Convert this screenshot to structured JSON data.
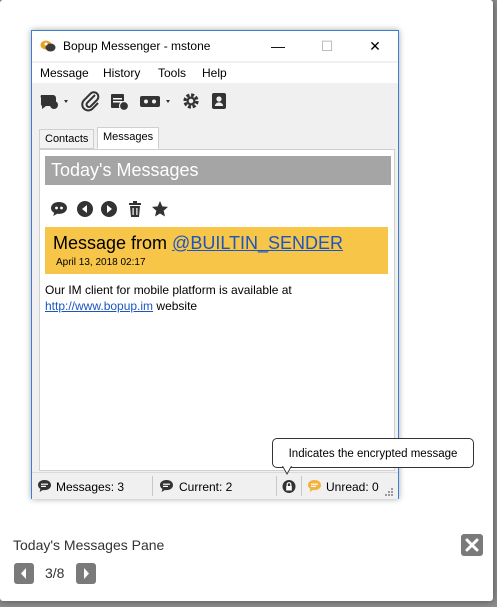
{
  "window": {
    "title": "Bopup Messenger - mstone",
    "minimize_label": "—",
    "maximize_label": "☐",
    "close_label": "✕"
  },
  "menu": [
    "Message",
    "History",
    "Tools",
    "Help"
  ],
  "tabs": [
    {
      "label": "Contacts",
      "active": false
    },
    {
      "label": "Messages",
      "active": true
    }
  ],
  "pane": {
    "header": "Today's Messages",
    "message": {
      "from_prefix": "Message from ",
      "sender": "@BUILTIN_SENDER",
      "date": "April 13, 2018 02:17",
      "body_line1": "Our IM client for mobile platform is available at",
      "link": "http://www.bopup.im",
      "body_suffix": " website"
    }
  },
  "status": {
    "messages": "Messages: 3",
    "current": "Current: 2",
    "unread": "Unread: 0"
  },
  "tooltip": "Indicates the encrypted message",
  "lightbox": {
    "caption": "Today's Messages Pane",
    "counter": "3/8"
  },
  "colors": {
    "message_highlight": "#f7c548",
    "pane_header": "#a5a5a5",
    "link": "#1a55c2",
    "unread_icon": "#f2b33d"
  }
}
